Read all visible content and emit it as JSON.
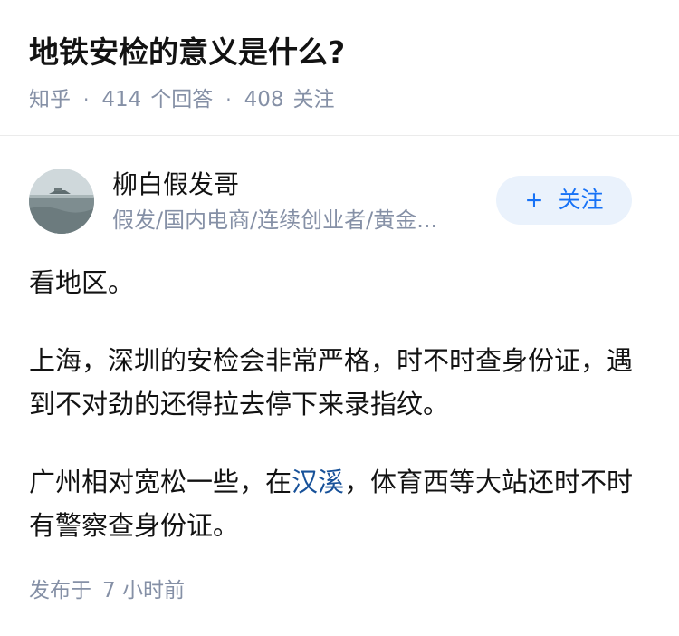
{
  "question": {
    "title": "地铁安检的意义是什么?",
    "source": "知乎",
    "answer_count": "414",
    "answer_label": "个回答",
    "follow_count": "408",
    "follow_label": "关注"
  },
  "author": {
    "name": "柳白假发哥",
    "bio": "假发/国内电商/连续创业者/黄金...",
    "follow_button": "关注",
    "follow_icon": "plus-icon"
  },
  "answer": {
    "p1": "看地区。",
    "p2": "上海，深圳的安检会非常严格，时不时查身份证，遇到不对劲的还得拉去停下来录指纹。",
    "p3_before": "广州相对宽松一些，在",
    "p3_link": "汉溪",
    "p3_after": "，体育西等大站还时不时有警察查身份证。"
  },
  "meta": {
    "published_label": "发布于",
    "published_time": "7 小时前"
  },
  "colors": {
    "title": "#121212",
    "meta_gray": "#8590a6",
    "link_blue": "#175199",
    "follow_blue": "#1772f6",
    "follow_bg": "#eaf2fc"
  }
}
